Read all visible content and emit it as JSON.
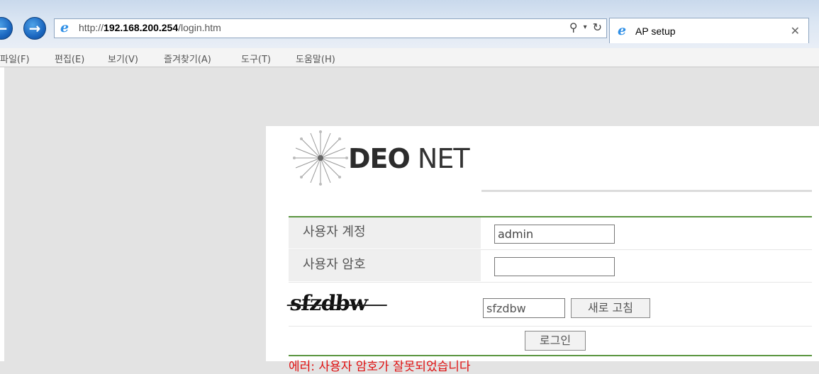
{
  "browser": {
    "url_prefix": "http://",
    "url_host": "192.168.200.254",
    "url_path": "/login.htm",
    "tab_title": "AP setup",
    "menu": [
      "파일(F)",
      "편집(E)",
      "보기(V)",
      "즐겨찾기(A)",
      "도구(T)",
      "도움말(H)"
    ]
  },
  "logo": {
    "strong": "DEO",
    "thin": "NET"
  },
  "form": {
    "username_label": "사용자 계정",
    "username_value": "admin",
    "password_label": "사용자 암호",
    "password_value": "",
    "captcha_text": "sfzdbw",
    "captcha_input_value": "sfzdbw",
    "refresh_label": "새로 고침",
    "login_label": "로그인"
  },
  "error": "에러: 사용자 암호가 잘못되었습니다"
}
